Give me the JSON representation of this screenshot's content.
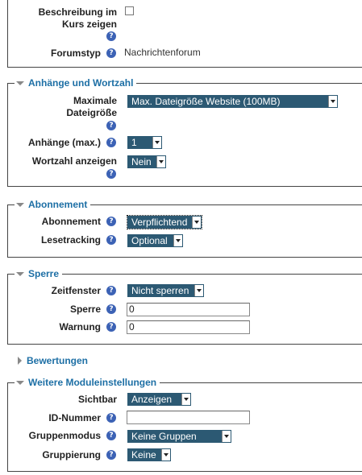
{
  "general": {
    "description_label_1": "Beschreibung im",
    "description_label_2": "Kurs zeigen",
    "forumtype_label": "Forumstyp",
    "forumtype_value": "Nachrichtenforum"
  },
  "attachments": {
    "legend": "Anhänge und Wortzahl",
    "maxsize_label_1": "Maximale",
    "maxsize_label_2": "Dateigröße",
    "maxsize_value": "Max. Dateigröße Website (100MB)",
    "attachments_label": "Anhänge (max.)",
    "attachments_value": "1",
    "wordcount_label": "Wortzahl anzeigen",
    "wordcount_value": "Nein"
  },
  "subscription": {
    "legend": "Abonnement",
    "subscription_label": "Abonnement",
    "subscription_value": "Verpflichtend",
    "tracking_label": "Lesetracking",
    "tracking_value": "Optional"
  },
  "lock": {
    "legend": "Sperre",
    "window_label": "Zeitfenster",
    "window_value": "Nicht sperren",
    "lock_label": "Sperre",
    "lock_value": "0",
    "warning_label": "Warnung",
    "warning_value": "0"
  },
  "ratings": {
    "legend": "Bewertungen"
  },
  "module": {
    "legend": "Weitere Moduleinstellungen",
    "visible_label": "Sichtbar",
    "visible_value": "Anzeigen",
    "idnumber_label": "ID-Nummer",
    "idnumber_value": "",
    "groupmode_label": "Gruppenmodus",
    "groupmode_value": "Keine Gruppen",
    "grouping_label": "Gruppierung",
    "grouping_value": "Keine"
  },
  "help_glyph": "?",
  "colors": {
    "legend": "#1d6fa5",
    "select_bg": "#2c5973",
    "help_bg": "#3c62b5"
  }
}
